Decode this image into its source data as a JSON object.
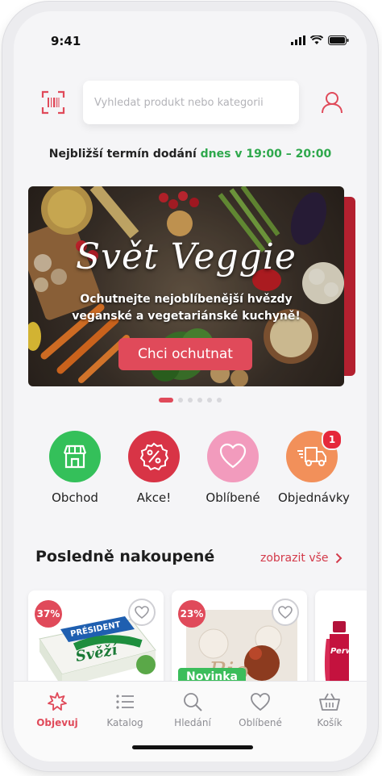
{
  "status": {
    "time": "9:41"
  },
  "header": {
    "search_placeholder": "Vyhledat produkt nebo kategorii"
  },
  "delivery": {
    "prefix": "Nejbližší termín dodání",
    "slot": "dnes v 19:00 – 20:00"
  },
  "banner": {
    "title": "Svět Veggie",
    "subtitle": "Ochutnejte nejoblíbenější hvězdy veganské a vegetariánské kuchyně!",
    "button": "Chci ochutnat",
    "pages": 6,
    "active_page": 1
  },
  "quick_actions": [
    {
      "label": "Obchod",
      "icon": "store-icon",
      "color": "#34c05a"
    },
    {
      "label": "Akce!",
      "icon": "discount-badge-icon",
      "color": "#d83446"
    },
    {
      "label": "Oblíbené",
      "icon": "heart-icon",
      "color": "#f29bbd"
    },
    {
      "label": "Objednávky",
      "icon": "delivery-truck-icon",
      "color": "#f2905a",
      "badge": "1"
    }
  ],
  "recent": {
    "title": "Posledně nakoupené",
    "show_all": "zobrazit vše",
    "products": [
      {
        "discount": "37%",
        "brand": "PRÉSIDENT",
        "name": "Svěží",
        "tag": ""
      },
      {
        "discount": "23%",
        "brand": "",
        "name": "Bio",
        "tag": "Novinka"
      },
      {
        "discount": "",
        "brand": "Perwoll",
        "name": "",
        "tag": ""
      }
    ]
  },
  "tabbar": {
    "items": [
      {
        "label": "Objevuj",
        "icon": "star-icon",
        "active": true
      },
      {
        "label": "Katalog",
        "icon": "list-icon",
        "active": false
      },
      {
        "label": "Hledání",
        "icon": "search-icon",
        "active": false
      },
      {
        "label": "Oblíbené",
        "icon": "heart-icon",
        "active": false
      },
      {
        "label": "Košík",
        "icon": "basket-icon",
        "active": false
      }
    ]
  },
  "colors": {
    "accent": "#e04a5a",
    "green": "#2ea84c"
  }
}
